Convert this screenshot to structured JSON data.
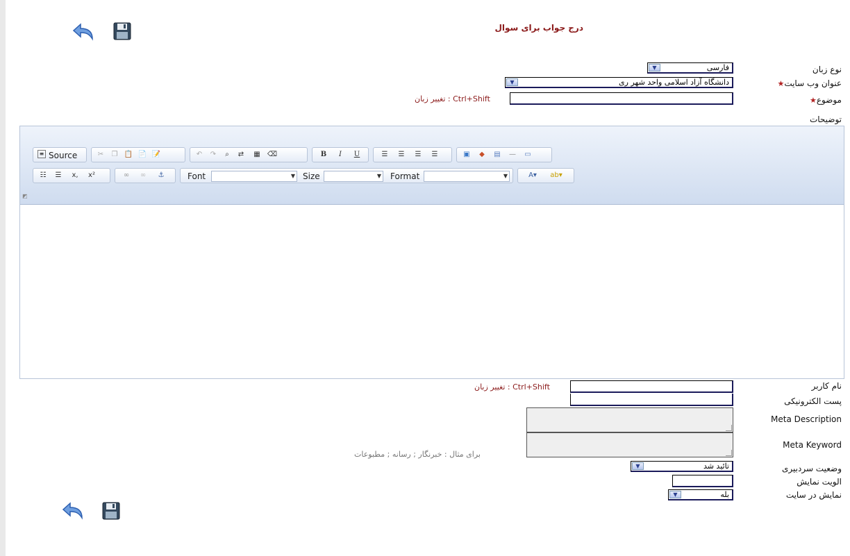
{
  "page": {
    "title": "درج جواب برای سوال"
  },
  "icons": {
    "back": "undo-arrow-icon",
    "save": "floppy-disk-icon"
  },
  "colors": {
    "title": "#8b1a1a",
    "hint": "#8b1a1a",
    "required_star": "#b22222",
    "editor_toolbar": "#d6e1f1"
  },
  "form": {
    "language_label": "نوع زبان",
    "language_value": "فارسی",
    "website_label": "عنوان وب سایت",
    "website_value": "دانشگاه آزاد اسلامی واحد شهر ری",
    "subject_label": "موضوع",
    "subject_hint": "تغییر زبان : Ctrl+Shift",
    "description_label": "توضیحات",
    "username_label": "نام کاربر",
    "username_hint": "تغییر زبان : Ctrl+Shift",
    "email_label": "پست الکترونیکی",
    "meta_description_label": "Meta Description",
    "meta_keyword_label": "Meta Keyword",
    "meta_keyword_hint": "برای مثال : خبرنگار ; رسانه ; مطبوعات",
    "editorial_status_label": "وضعیت سردبیری",
    "editorial_status_value": "تائید شد",
    "display_priority_label": "الویت نمایش",
    "show_on_site_label": "نمایش در سایت",
    "show_on_site_value": "بله"
  },
  "editor": {
    "source_label": "Source",
    "font_label": "Font",
    "size_label": "Size",
    "format_label": "Format",
    "bold": "B",
    "italic": "I",
    "underline": "U",
    "subscript": "x,",
    "superscript": "x²"
  }
}
